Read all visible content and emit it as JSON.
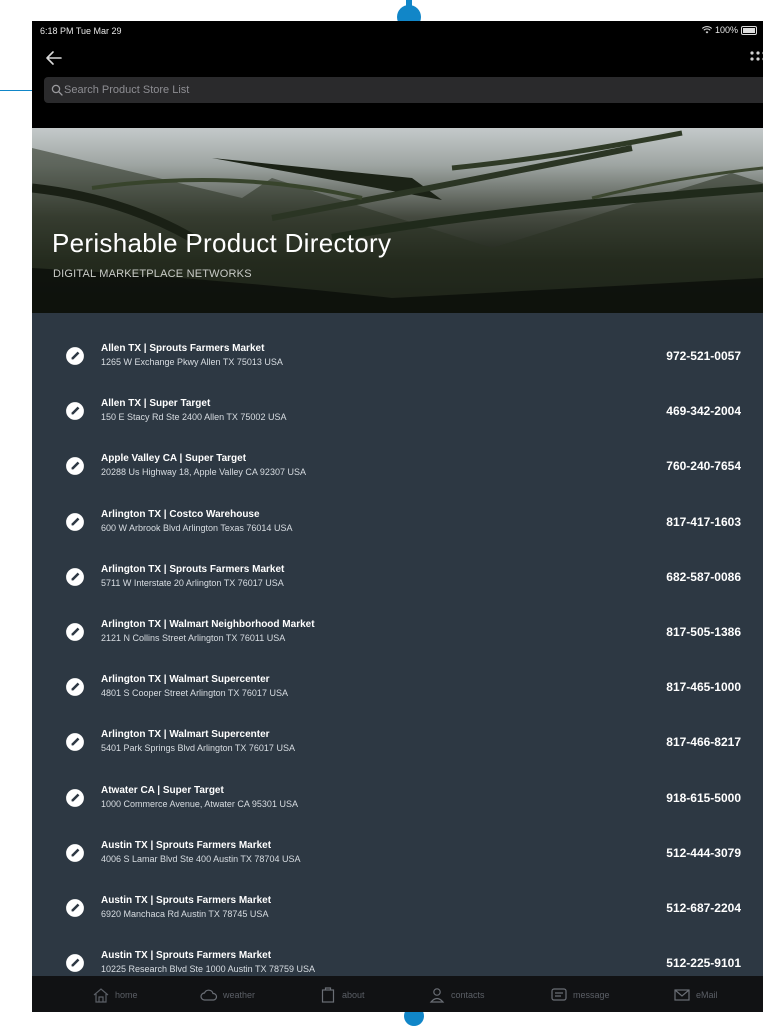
{
  "status": {
    "time": "6:18 PM  Tue Mar 29",
    "battery": "100%"
  },
  "search": {
    "placeholder": "Search Product Store List"
  },
  "header": {
    "title": "Perishable Product Directory",
    "subtitle": "DIGITAL MARKETPLACE NETWORKS"
  },
  "stores": [
    {
      "name": "Allen TX | Sprouts Farmers Market",
      "address": "1265 W Exchange Pkwy Allen TX 75013 USA",
      "phone": "972-521-0057"
    },
    {
      "name": "Allen TX | Super Target",
      "address": "150 E Stacy Rd Ste 2400 Allen TX 75002 USA",
      "phone": "469-342-2004"
    },
    {
      "name": "Apple Valley CA | Super Target",
      "address": "20288 Us Highway 18, Apple Valley CA 92307 USA",
      "phone": "760-240-7654"
    },
    {
      "name": "Arlington TX | Costco Warehouse",
      "address": "600 W Arbrook Blvd Arlington Texas 76014 USA",
      "phone": "817-417-1603"
    },
    {
      "name": "Arlington TX | Sprouts Farmers Market",
      "address": "5711 W Interstate 20 Arlington TX 76017 USA",
      "phone": "682-587-0086"
    },
    {
      "name": "Arlington TX | Walmart Neighborhood Market",
      "address": "2121 N Collins Street Arlington TX 76011 USA",
      "phone": "817-505-1386"
    },
    {
      "name": "Arlington TX | Walmart Supercenter",
      "address": "4801 S Cooper Street Arlington TX 76017 USA",
      "phone": "817-465-1000"
    },
    {
      "name": "Arlington TX | Walmart Supercenter",
      "address": "5401 Park Springs Blvd Arlington TX 76017 USA",
      "phone": "817-466-8217"
    },
    {
      "name": "Atwater CA | Super Target",
      "address": "1000 Commerce Avenue, Atwater CA 95301 USA",
      "phone": "918-615-5000"
    },
    {
      "name": "Austin TX | Sprouts Farmers Market",
      "address": "4006 S Lamar Blvd Ste 400 Austin TX 78704 USA",
      "phone": "512-444-3079"
    },
    {
      "name": "Austin TX | Sprouts Farmers Market",
      "address": "6920 Manchaca Rd Austin TX 78745 USA",
      "phone": "512-687-2204"
    },
    {
      "name": "Austin TX | Sprouts Farmers Market",
      "address": "10225 Research Blvd Ste 1000 Austin TX 78759 USA",
      "phone": "512-225-9101"
    }
  ],
  "tabs": [
    {
      "label": "home",
      "icon": "home-icon"
    },
    {
      "label": "weather",
      "icon": "cloud-icon"
    },
    {
      "label": "about",
      "icon": "about-icon"
    },
    {
      "label": "contacts",
      "icon": "contacts-icon"
    },
    {
      "label": "message",
      "icon": "message-icon"
    },
    {
      "label": "eMail",
      "icon": "mail-icon"
    }
  ],
  "colors": {
    "list_background": "#2d3843",
    "accent": "#1186c8",
    "tab_bar": "#111214"
  }
}
